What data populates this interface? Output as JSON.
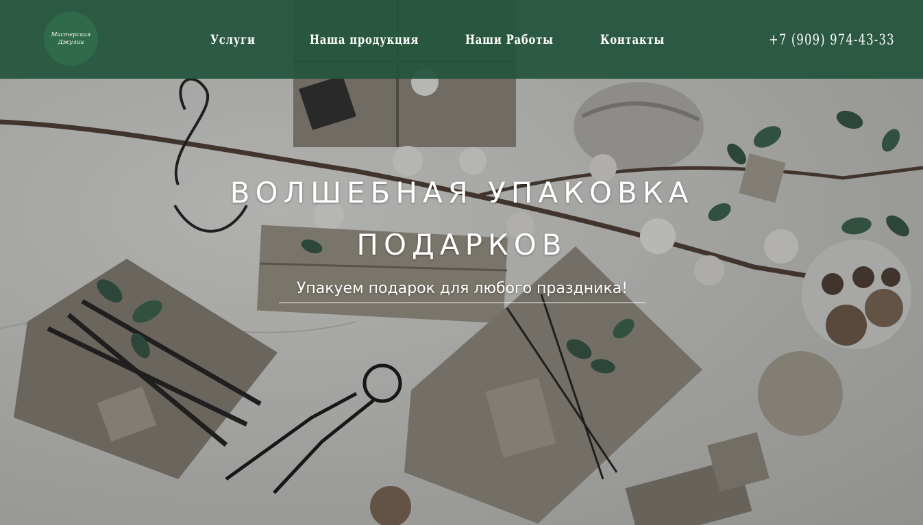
{
  "header": {
    "logo": {
      "line1": "Мастерская",
      "line2": "Джулии"
    },
    "nav": [
      {
        "label": "Услуги"
      },
      {
        "label": "Наша продукция"
      },
      {
        "label": "Наши Работы"
      },
      {
        "label": "Контакты"
      }
    ],
    "phone": "+7 (909) 974-43-33"
  },
  "hero": {
    "title": "ВОЛШЕБНАЯ УПАКОВКА ПОДАРКОВ",
    "subtitle": "Упакуем подарок для любого праздника!"
  },
  "colors": {
    "header_bg": "#24543c",
    "logo_bg": "#2f6a4b",
    "text": "#ffffff"
  }
}
